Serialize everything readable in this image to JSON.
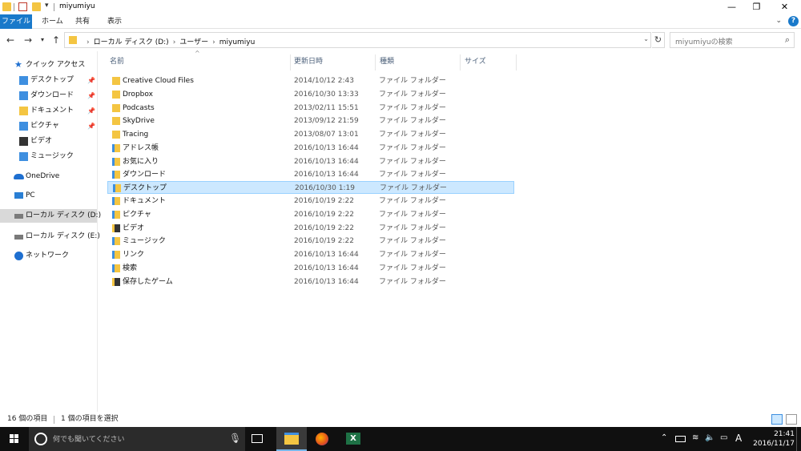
{
  "window": {
    "title": "miyumiyu",
    "controls": {
      "minimize": "—",
      "restore": "❐",
      "close": "✕"
    }
  },
  "ribbon": {
    "tabs": [
      "ファイル",
      "ホーム",
      "共有",
      "表示"
    ]
  },
  "address": {
    "crumbs": [
      "ローカル ディスク (D:)",
      "ユーザー",
      "miyumiyu"
    ],
    "search_placeholder": "miyumiyuの検索"
  },
  "nav": {
    "quick_access": "クイック アクセス",
    "quick_items": [
      "デスクトップ",
      "ダウンロード",
      "ドキュメント",
      "ピクチャ",
      "ビデオ",
      "ミュージック"
    ],
    "onedrive": "OneDrive",
    "pc": "PC",
    "drive_d": "ローカル ディスク (D:)",
    "drive_e": "ローカル ディスク (E:)",
    "network": "ネットワーク"
  },
  "list": {
    "columns": {
      "name": "名前",
      "date": "更新日時",
      "type": "種類",
      "size": "サイズ"
    },
    "rows": [
      {
        "name": "Creative Cloud Files",
        "date": "2014/10/12 2:43",
        "type": "ファイル フォルダー"
      },
      {
        "name": "Dropbox",
        "date": "2016/10/30 13:33",
        "type": "ファイル フォルダー"
      },
      {
        "name": "Podcasts",
        "date": "2013/02/11 15:51",
        "type": "ファイル フォルダー"
      },
      {
        "name": "SkyDrive",
        "date": "2013/09/12 21:59",
        "type": "ファイル フォルダー"
      },
      {
        "name": "Tracing",
        "date": "2013/08/07 13:01",
        "type": "ファイル フォルダー"
      },
      {
        "name": "アドレス帳",
        "date": "2016/10/13 16:44",
        "type": "ファイル フォルダー"
      },
      {
        "name": "お気に入り",
        "date": "2016/10/13 16:44",
        "type": "ファイル フォルダー"
      },
      {
        "name": "ダウンロード",
        "date": "2016/10/13 16:44",
        "type": "ファイル フォルダー"
      },
      {
        "name": "デスクトップ",
        "date": "2016/10/30 1:19",
        "type": "ファイル フォルダー"
      },
      {
        "name": "ドキュメント",
        "date": "2016/10/19 2:22",
        "type": "ファイル フォルダー"
      },
      {
        "name": "ピクチャ",
        "date": "2016/10/19 2:22",
        "type": "ファイル フォルダー"
      },
      {
        "name": "ビデオ",
        "date": "2016/10/19 2:22",
        "type": "ファイル フォルダー"
      },
      {
        "name": "ミュージック",
        "date": "2016/10/19 2:22",
        "type": "ファイル フォルダー"
      },
      {
        "name": "リンク",
        "date": "2016/10/13 16:44",
        "type": "ファイル フォルダー"
      },
      {
        "name": "検索",
        "date": "2016/10/13 16:44",
        "type": "ファイル フォルダー"
      },
      {
        "name": "保存したゲーム",
        "date": "2016/10/13 16:44",
        "type": "ファイル フォルダー"
      }
    ]
  },
  "status": {
    "count": "16 個の項目",
    "selected": "1 個の項目を選択"
  },
  "taskbar": {
    "search_placeholder": "何でも聞いてください",
    "ime": "A",
    "time": "21:41",
    "date": "2016/11/17"
  }
}
